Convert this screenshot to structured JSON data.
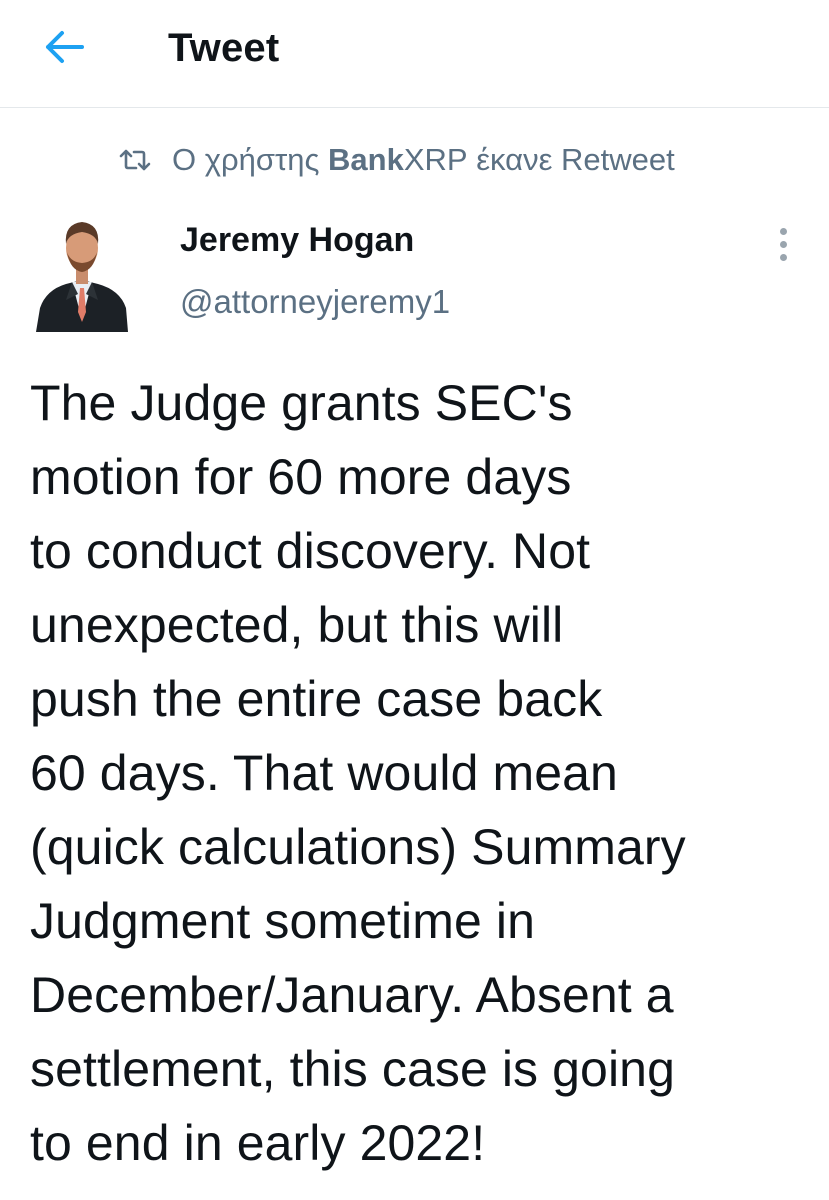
{
  "header": {
    "title": "Tweet",
    "accent_color": "#1da1f2"
  },
  "retweet": {
    "prefix": "Ο χρήστης ",
    "user": "Bank",
    "user_rest": "XRP",
    "suffix": " έκανε Retweet"
  },
  "author": {
    "name": "Jeremy Hogan",
    "handle": "@attorneyjeremy1"
  },
  "tweet": {
    "text": "The Judge grants SEC's\nmotion for 60 more days\nto conduct discovery. Not\nunexpected, but this will\npush the entire case back\n60 days. That would mean\n(quick calculations) Summary\nJudgment sometime in\nDecember/January.  Absent a\nsettlement, this case is going\nto end in early 2022!"
  },
  "icons": {
    "back": "arrow-left-icon",
    "retweet": "retweet-icon",
    "more": "more-vertical-icon"
  }
}
